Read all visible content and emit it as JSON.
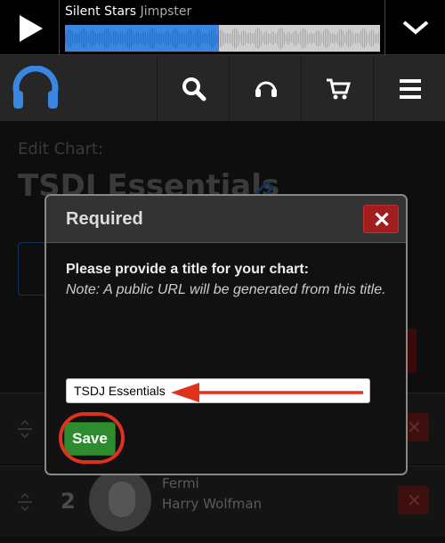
{
  "player": {
    "track_title": "Silent Stars",
    "track_artist": "Jimpster",
    "progress": 0.49,
    "waveform_color": "#3b86e0"
  },
  "nav": {
    "icons": [
      "headphones-logo-icon",
      "search-icon",
      "support-icon",
      "cart-icon",
      "menu-icon"
    ]
  },
  "page": {
    "edit_label": "Edit Chart:",
    "chart_title": "TSDJ Essentials",
    "tracks": [
      {
        "number": "2",
        "title": "Fermi",
        "artist": "Harry Wolfman"
      }
    ]
  },
  "modal": {
    "title": "Required",
    "close_label": "✕",
    "prompt": "Please provide a title for your chart:",
    "note": "Note: A public URL will be generated from this title.",
    "input_value": "TSDJ Essentials",
    "save_label": "Save",
    "annotation_color": "#e0301e"
  }
}
